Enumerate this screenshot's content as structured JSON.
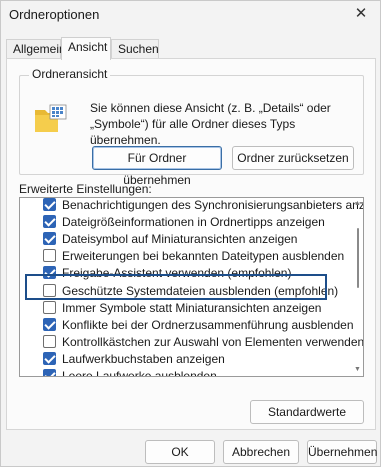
{
  "window": {
    "title": "Ordneroptionen"
  },
  "tabs": [
    {
      "label": "Allgemein",
      "active": false
    },
    {
      "label": "Ansicht",
      "active": true
    },
    {
      "label": "Suchen",
      "active": false
    }
  ],
  "folder_view": {
    "legend": "Ordneransicht",
    "description": "Sie können diese Ansicht (z. B. „Details“ oder „Symbole“) für alle Ordner dieses Typs übernehmen.",
    "apply_button": "Für Ordner übernehmen",
    "reset_button": "Ordner zurücksetzen"
  },
  "advanced": {
    "label": "Erweiterte Einstellungen:",
    "items": [
      {
        "label": "Benachrichtigungen des Synchronisierungsanbieters anzeig",
        "checked": true
      },
      {
        "label": "Dateigrößeinformationen in Ordnertipps anzeigen",
        "checked": true
      },
      {
        "label": "Dateisymbol auf Miniaturansichten anzeigen",
        "checked": true
      },
      {
        "label": "Erweiterungen bei bekannten Dateitypen ausblenden",
        "checked": false
      },
      {
        "label": "Freigabe-Assistent verwenden (empfohlen)",
        "checked": true
      },
      {
        "label": "Geschützte Systemdateien ausblenden (empfohlen)",
        "checked": false,
        "selected": true
      },
      {
        "label": "Immer Symbole statt Miniaturansichten anzeigen",
        "checked": false
      },
      {
        "label": "Konflikte bei der Ordnerzusammenführung ausblenden",
        "checked": true
      },
      {
        "label": "Kontrollkästchen zur Auswahl von Elementen verwenden",
        "checked": false
      },
      {
        "label": "Laufwerkbuchstaben anzeigen",
        "checked": true
      },
      {
        "label": "Leere Laufwerke ausblenden",
        "checked": true
      }
    ],
    "defaults_button": "Standardwerte"
  },
  "footer": {
    "ok_button": "OK",
    "cancel_button": "Abbrechen",
    "apply_button": "Übernehmen"
  },
  "icons": {
    "close": "close-icon",
    "folder": "folder-view-icon"
  },
  "colors": {
    "checkbox_checked": "#2d64b6",
    "selection_outline": "#1d4e8a"
  }
}
